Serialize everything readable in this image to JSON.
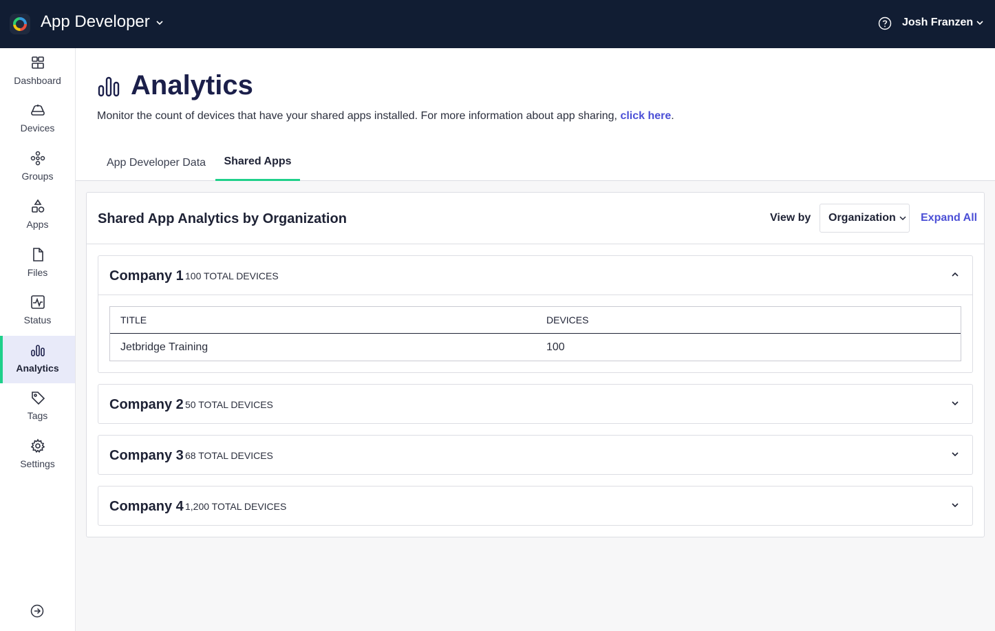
{
  "topbar": {
    "app_title": "App Developer",
    "user_name": "Josh Franzen",
    "logo_icon": "app-logo",
    "help_icon": "help-circle-icon"
  },
  "sidebar": {
    "items": [
      {
        "label": "Dashboard",
        "icon": "dashboard-icon"
      },
      {
        "label": "Devices",
        "icon": "devices-icon"
      },
      {
        "label": "Groups",
        "icon": "groups-icon"
      },
      {
        "label": "Apps",
        "icon": "apps-icon"
      },
      {
        "label": "Files",
        "icon": "file-icon"
      },
      {
        "label": "Status",
        "icon": "status-icon"
      },
      {
        "label": "Analytics",
        "icon": "analytics-icon",
        "active": true
      },
      {
        "label": "Tags",
        "icon": "tag-icon"
      },
      {
        "label": "Settings",
        "icon": "gear-icon"
      }
    ],
    "collapse_icon": "arrow-right-circle-icon"
  },
  "page": {
    "title": "Analytics",
    "description": "Monitor the count of devices that have your shared apps installed. For more information about app sharing, ",
    "link_text": "click here",
    "description_end": "."
  },
  "tabs": [
    {
      "label": "App Developer Data",
      "active": false
    },
    {
      "label": "Shared Apps",
      "active": true
    }
  ],
  "card": {
    "title": "Shared App Analytics by Organization",
    "view_by_label": "View by",
    "view_by_value": "Organization",
    "expand_all": "Expand All"
  },
  "companies": [
    {
      "name": "Company 1",
      "count": "100 TOTAL DEVICES",
      "expanded": true,
      "table": {
        "headers": [
          "TITLE",
          "DEVICES"
        ],
        "rows": [
          [
            "Jetbridge Training",
            "100"
          ]
        ]
      }
    },
    {
      "name": "Company 2",
      "count": "50 TOTAL DEVICES",
      "expanded": false
    },
    {
      "name": "Company 3",
      "count": "68 TOTAL DEVICES",
      "expanded": false
    },
    {
      "name": "Company 4",
      "count": "1,200 TOTAL DEVICES",
      "expanded": false
    }
  ],
  "colors": {
    "topbar": "#111d33",
    "accent_green": "#1fd08a",
    "link_blue": "#4b4fd6",
    "active_nav_bg": "#e8eaf9"
  }
}
